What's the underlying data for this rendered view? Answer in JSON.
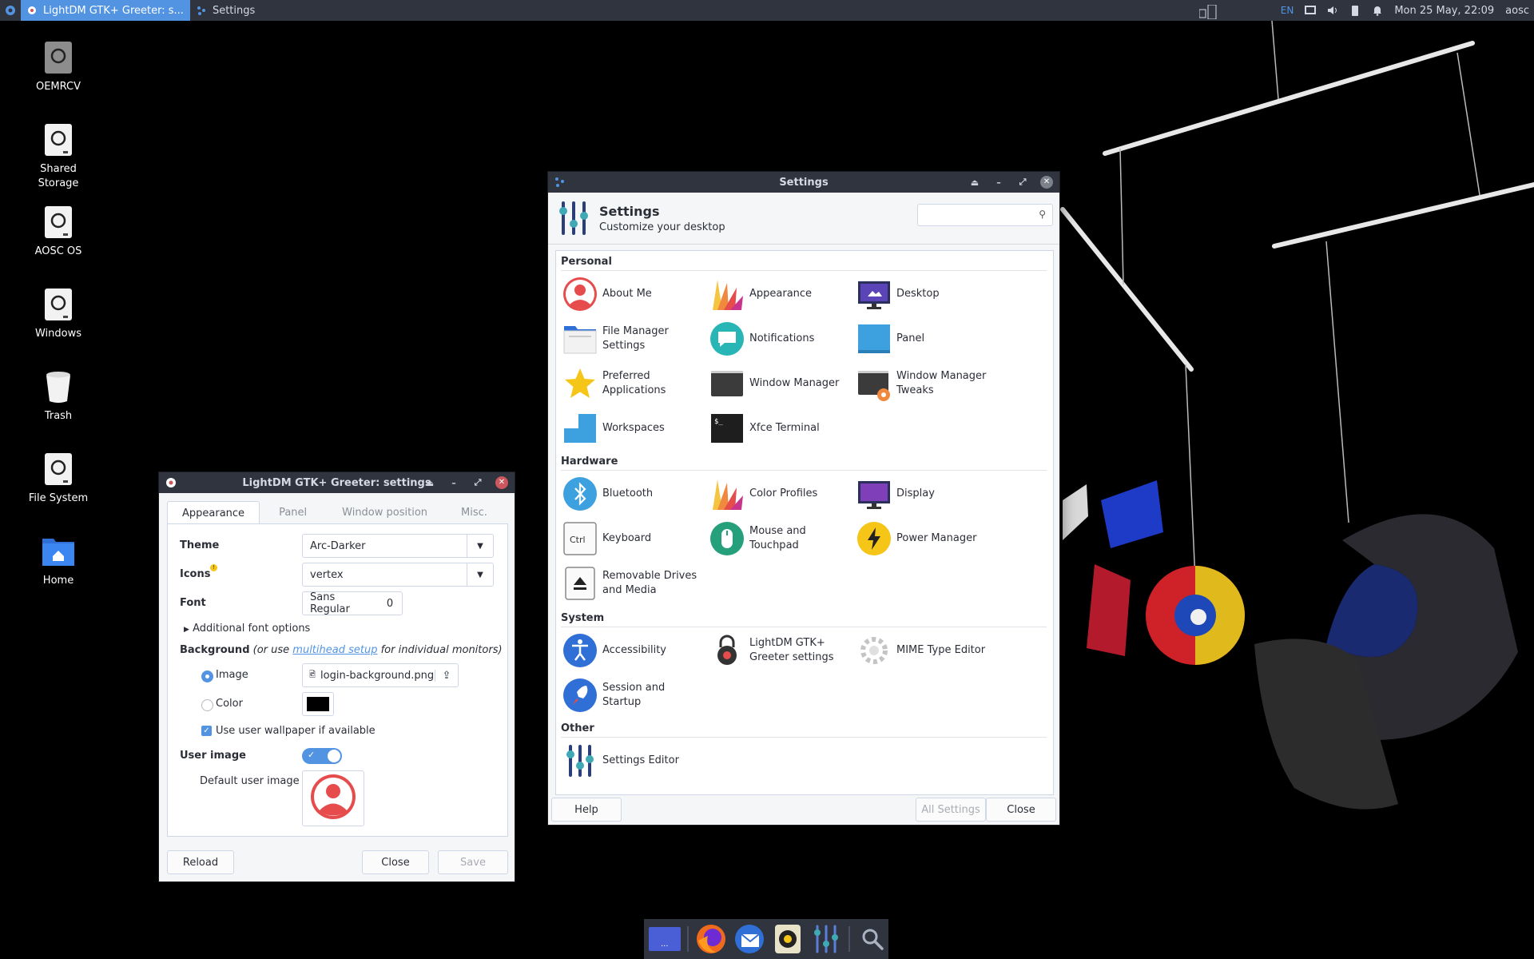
{
  "top_panel": {
    "apps": [
      {
        "label": "LightDM GTK+ Greeter: s...",
        "active": true
      },
      {
        "label": "Settings",
        "active": false
      }
    ],
    "keyboard_layout": "EN",
    "clock": "Mon 25 May, 22:09",
    "user": "aosc",
    "tray_icons": [
      "workspace-switcher-icon",
      "display-icon",
      "volume-icon",
      "battery-icon",
      "notification-bell-icon"
    ]
  },
  "desktop": {
    "icons": [
      {
        "label": "OEMRCV",
        "icon": "drive-icon"
      },
      {
        "label": "Shared Storage",
        "icon": "drive-icon"
      },
      {
        "label": "AOSC OS",
        "icon": "drive-icon"
      },
      {
        "label": "Windows",
        "icon": "drive-icon"
      },
      {
        "label": "Trash",
        "icon": "trash-icon"
      },
      {
        "label": "File System",
        "icon": "drive-icon"
      },
      {
        "label": "Home",
        "icon": "home-folder-icon"
      }
    ]
  },
  "settings": {
    "window_title": "Settings",
    "header_title": "Settings",
    "header_subtitle": "Customize your desktop",
    "search_value": "",
    "sections": [
      {
        "title": "Personal",
        "items": [
          {
            "label": "About Me",
            "icon": "about-me-icon"
          },
          {
            "label": "Appearance",
            "icon": "appearance-icon"
          },
          {
            "label": "Desktop",
            "icon": "desktop-icon"
          },
          {
            "label": "File Manager Settings",
            "icon": "file-manager-icon"
          },
          {
            "label": "Notifications",
            "icon": "notifications-icon"
          },
          {
            "label": "Panel",
            "icon": "panel-icon"
          },
          {
            "label": "Preferred Applications",
            "icon": "preferred-apps-icon"
          },
          {
            "label": "Window Manager",
            "icon": "window-manager-icon"
          },
          {
            "label": "Window Manager Tweaks",
            "icon": "wm-tweaks-icon"
          },
          {
            "label": "Workspaces",
            "icon": "workspaces-icon"
          },
          {
            "label": "Xfce Terminal",
            "icon": "terminal-icon"
          }
        ]
      },
      {
        "title": "Hardware",
        "items": [
          {
            "label": "Bluetooth",
            "icon": "bluetooth-icon"
          },
          {
            "label": "Color Profiles",
            "icon": "color-profiles-icon"
          },
          {
            "label": "Display",
            "icon": "display-icon"
          },
          {
            "label": "Keyboard",
            "icon": "keyboard-icon"
          },
          {
            "label": "Mouse and Touchpad",
            "icon": "mouse-icon"
          },
          {
            "label": "Power Manager",
            "icon": "power-icon"
          },
          {
            "label": "Removable Drives and Media",
            "icon": "removable-drive-icon"
          }
        ]
      },
      {
        "title": "System",
        "items": [
          {
            "label": "Accessibility",
            "icon": "accessibility-icon"
          },
          {
            "label": "LightDM GTK+ Greeter settings",
            "icon": "lightdm-icon"
          },
          {
            "label": "MIME Type Editor",
            "icon": "mime-icon"
          },
          {
            "label": "Session and Startup",
            "icon": "session-icon"
          }
        ]
      },
      {
        "title": "Other",
        "items": [
          {
            "label": "Settings Editor",
            "icon": "settings-editor-icon"
          }
        ]
      }
    ],
    "buttons": {
      "help": "Help",
      "all_settings": "All Settings",
      "close": "Close"
    }
  },
  "lightdm": {
    "window_title": "LightDM GTK+ Greeter: settings",
    "tabs": [
      "Appearance",
      "Panel",
      "Window position",
      "Misc."
    ],
    "theme_label": "Theme",
    "theme_value": "Arc-Darker",
    "icons_label": "Icons",
    "icons_value": "vertex",
    "font_label": "Font",
    "font_value": "Sans Regular",
    "font_size": "0",
    "additional_font": "Additional font options",
    "background_label": "Background",
    "background_hint_pre": "(or use ",
    "background_hint_link": "multihead setup",
    "background_hint_post": " for individual monitors)",
    "image_label": "Image",
    "image_file": "login-background.png",
    "color_label": "Color",
    "color_value": "#000000",
    "user_wallpaper": "Use user wallpaper if available",
    "user_image_label": "User image",
    "default_user_image_label": "Default user image",
    "buttons": {
      "reload": "Reload",
      "close": "Close",
      "save": "Save"
    }
  },
  "dock": {
    "items": [
      "show-desktop-icon",
      "firefox-icon",
      "thunderbird-icon",
      "rhythmbox-icon",
      "settings-manager-icon",
      "app-finder-icon"
    ]
  },
  "colors": {
    "accent": "#5294e2",
    "panel": "#2f343f",
    "close": "#cc575d"
  }
}
